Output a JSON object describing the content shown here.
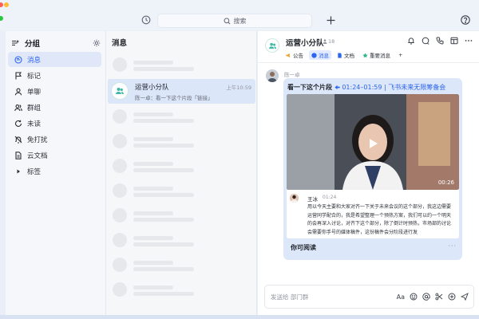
{
  "titlebar": {
    "search_placeholder": "搜索",
    "icons": [
      "history-icon",
      "search-icon",
      "plus-icon",
      "help-icon"
    ]
  },
  "sidebar": {
    "title": "分组",
    "items": [
      {
        "label": "消息",
        "icon": "message-icon",
        "active": true
      },
      {
        "label": "标记",
        "icon": "flag-icon"
      },
      {
        "label": "单聊",
        "icon": "person-icon"
      },
      {
        "label": "群组",
        "icon": "group-icon"
      },
      {
        "label": "未读",
        "icon": "refresh-icon"
      },
      {
        "label": "免打扰",
        "icon": "bell-off-icon"
      },
      {
        "label": "云文档",
        "icon": "document-icon"
      },
      {
        "label": "标签",
        "icon": "caret-right-icon"
      }
    ]
  },
  "message_list": {
    "title": "消息",
    "active_chat": {
      "name": "运营小分队",
      "preview": "陈一卓：看一下这个片段「链接」",
      "time": "上午10:59"
    }
  },
  "conversation": {
    "group_name": "运营小分队",
    "member_count": "18",
    "tabs": [
      {
        "label": "公告",
        "icon": "announcement-icon"
      },
      {
        "label": "消息",
        "icon": "chat-icon",
        "active": true
      },
      {
        "label": "文档",
        "icon": "doc-icon"
      },
      {
        "label": "重要消息",
        "icon": "pin-icon"
      }
    ],
    "tab_add": "+",
    "header_icons": [
      "notification-icon",
      "mention-icon",
      "call-icon",
      "window-icon",
      "more-icon"
    ],
    "sender": "陈一卓",
    "card": {
      "title_prefix": "看一下这个片段",
      "title_link": "01:24–01:59 | 飞书未来无限筹备会",
      "video_duration": "00:26",
      "speaker": "王冰",
      "speaker_time": "01:24",
      "transcript": "用以今天主要和大家对齐一下关于未来会议的这个部分，我这边需要运营同学配合的，我是希望整理一个预热方案，我们可以约一个明天的会再深入讨论，对齐下这个部分，除了倒计时预热，市场部的讨论会需要你手号的媒体稿件，这份稿件会分阶段进行发",
      "read_more": "你可阅读",
      "more": "···"
    },
    "composer": {
      "placeholder": "发送给 部门群",
      "tools": [
        "Aa",
        "emoji-icon",
        "at-icon",
        "scissors-icon",
        "add-circle-icon",
        "send-icon"
      ]
    }
  }
}
